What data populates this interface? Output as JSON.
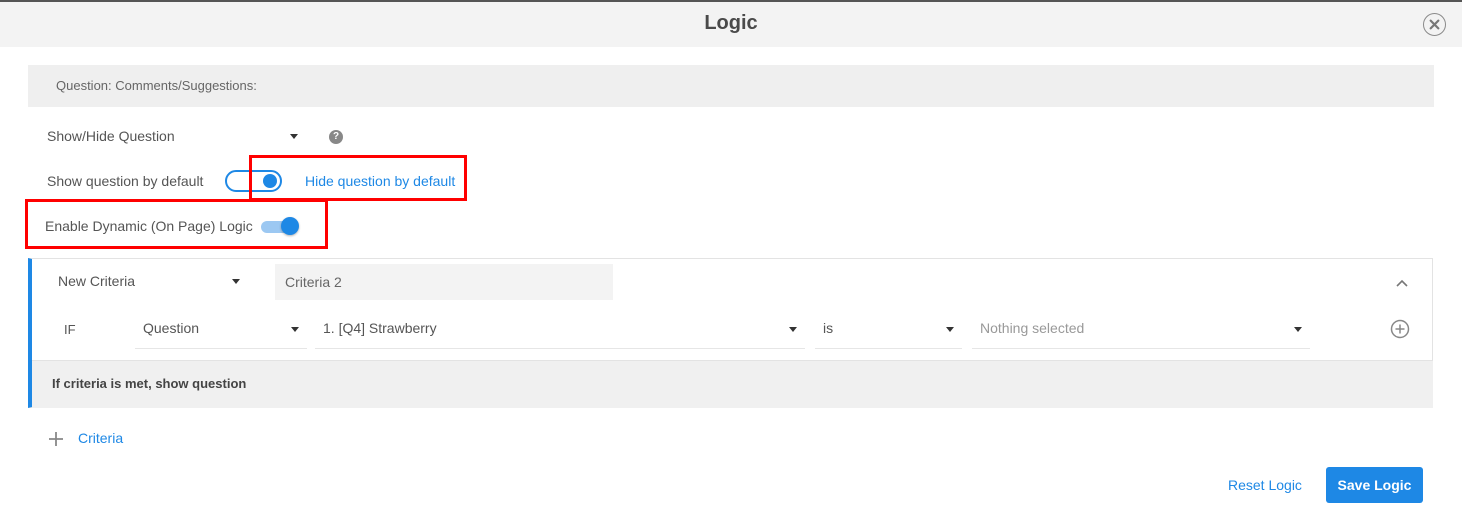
{
  "modal": {
    "title": "Logic",
    "close_icon": "close-circle-icon"
  },
  "question": {
    "text": "Question: Comments/Suggestions:"
  },
  "logic_type": {
    "selected": "Show/Hide Question",
    "help_icon": "question-circle-icon",
    "help_glyph": "?"
  },
  "default_visibility": {
    "left_label": "Show question by default",
    "right_label": "Hide question by default",
    "state": "hide"
  },
  "dynamic_logic": {
    "label": "Enable Dynamic (On Page) Logic",
    "enabled": true
  },
  "criteria": [
    {
      "type_selected": "New Criteria",
      "name_value": "Criteria 2",
      "condition": {
        "prefix": "IF",
        "source": "Question",
        "question": "1. [Q4] Strawberry",
        "operator": "is",
        "answer_placeholder": "Nothing selected"
      },
      "action_text": "If criteria is met, show question"
    }
  ],
  "add_criteria_label": "Criteria",
  "footer": {
    "reset_label": "Reset Logic",
    "save_label": "Save Logic"
  },
  "colors": {
    "accent": "#1e88e5",
    "highlight_box": "#ff0000",
    "header_bg": "#f3f3f3"
  }
}
